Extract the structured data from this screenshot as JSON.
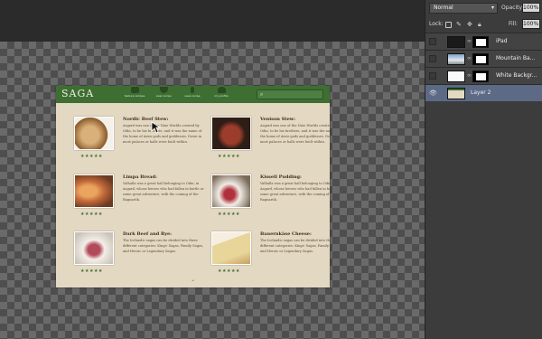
{
  "layers_panel": {
    "blend_mode": "Normal",
    "opacity_label": "Opacity:",
    "opacity_value": "100%",
    "lock_label": "Lock:",
    "fill_label": "Fill:",
    "fill_value": "100%",
    "layers": [
      {
        "name": "iPad"
      },
      {
        "name": "Mountain Ba..."
      },
      {
        "name": "White Backgr..."
      },
      {
        "name": "Layer 2"
      }
    ]
  },
  "site": {
    "logo": "SAGA",
    "nav": [
      {
        "label": "feature recipes",
        "icon": "book-icon"
      },
      {
        "label": "view recipe",
        "icon": "bowl-icon"
      },
      {
        "label": "save recipe",
        "icon": "spoon-icon"
      },
      {
        "label": "my profile",
        "icon": "person-icon"
      }
    ],
    "stars": "★★★★★",
    "recipes": [
      {
        "title": "Nordic Beef Stew:",
        "body": "Asgard was one of the Nine Worlds created by Odin, to be his brothers, and it was the name of the home of Aesir gods and goddesses. Down in most palaces or halls were built within.",
        "colors": [
          "#8a5a2a",
          "#d9b07a"
        ]
      },
      {
        "title": "Venison Stew:",
        "body": "Asgard was one of the Nine Worlds created by Odin, to be his brothers, and it was the name of the home of Aesir gods and goddesses. Down in most palaces or halls were built within.",
        "colors": [
          "#2e1e16",
          "#9b3c2c"
        ]
      },
      {
        "title": "Limpa Bread:",
        "body": "Valhalla was a great hall belonging to Odin, in Asgard, whose heroes who had fallen in battle or some great adventure, with the coming of the Ragnarök.",
        "colors": [
          "#c46a3a",
          "#e9a45e"
        ]
      },
      {
        "title": "Kissell Pudding:",
        "body": "Valhalla was a great hall belonging to Odin, in Asgard, whose heroes who had fallen in battle or some great adventure, with the coming of the Ragnarök.",
        "colors": [
          "#f1ece4",
          "#b0303c"
        ]
      },
      {
        "title": "Dark Beef and Rye:",
        "body": "The Icelandic sagas can be divided into three different categories: Kings' Sagas, Family Sagas, and Heroic or Legendary Sagas.",
        "colors": [
          "#f3eee8",
          "#b34a5a"
        ]
      },
      {
        "title": "Bauernkäse Cheese:",
        "body": "The Icelandic sagas can be divided into three different categories: Kings' Sagas, Family Sagas, and Heroic or Legendary Sagas.",
        "colors": [
          "#e8d59a",
          "#c8a060"
        ]
      }
    ]
  }
}
